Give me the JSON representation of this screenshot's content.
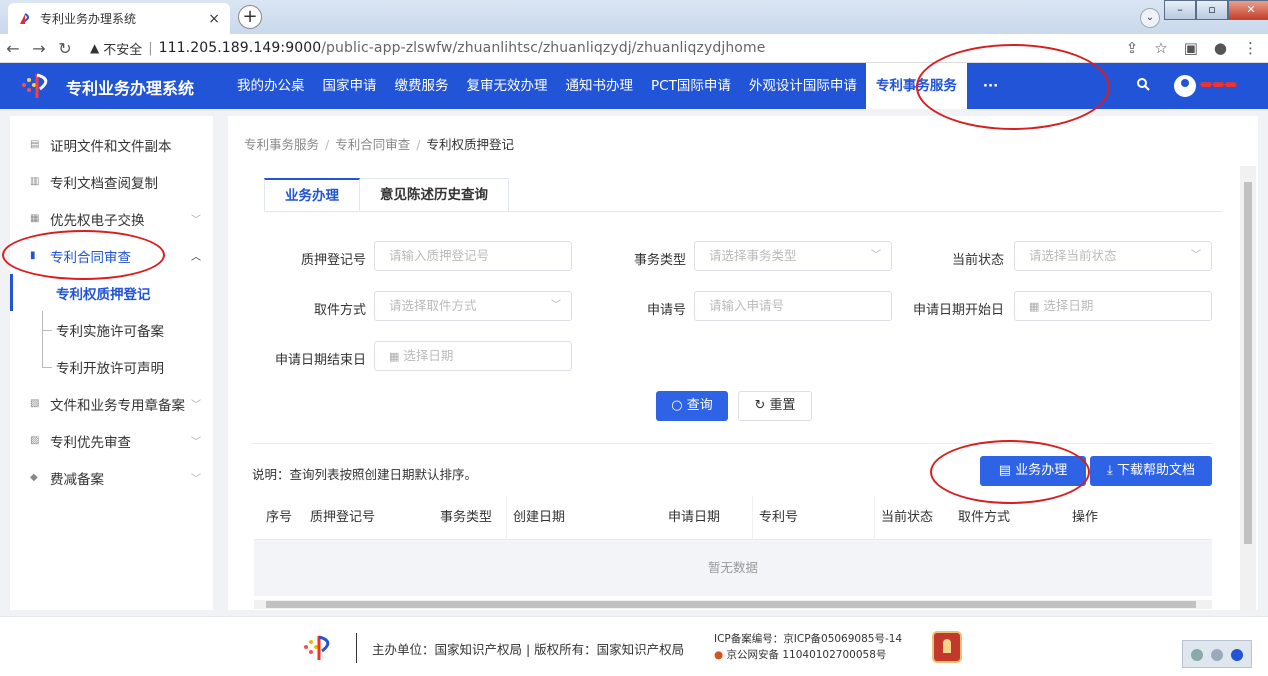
{
  "browser": {
    "tab_title": "专利业务办理系统",
    "tab_close": "×",
    "new_tab": "+",
    "security_label": "不安全",
    "url_host": "111.205.189.149:9000",
    "url_path": "/public-app-zlswfw/zhuanlihtsc/zhuanliqzydj/zhuanliqzydjhome"
  },
  "header": {
    "app_title": "专利业务办理系统",
    "nav": [
      "我的办公桌",
      "国家申请",
      "缴费服务",
      "复审无效办理",
      "通知书办理",
      "PCT国际申请",
      "外观设计国际申请",
      "专利事务服务",
      "···"
    ],
    "active_nav": "专利事务服务"
  },
  "sidebar": {
    "items": [
      {
        "label": "证明文件和文件副本",
        "icon": "document-icon"
      },
      {
        "label": "专利文档查阅复制",
        "icon": "copy-icon"
      },
      {
        "label": "优先权电子交换",
        "icon": "exchange-icon",
        "expandable": true
      },
      {
        "label": "专利合同审查",
        "icon": "contract-icon",
        "expandable": true,
        "open": true
      }
    ],
    "subitems": [
      "专利权质押登记",
      "专利实施许可备案",
      "专利开放许可声明"
    ],
    "items_after": [
      {
        "label": "文件和业务专用章备案",
        "icon": "stamp-icon",
        "expandable": true
      },
      {
        "label": "专利优先审查",
        "icon": "priority-icon",
        "expandable": true
      },
      {
        "label": "费减备案",
        "icon": "discount-icon",
        "expandable": true
      }
    ]
  },
  "breadcrumb": [
    "专利事务服务",
    "专利合同审查",
    "专利权质押登记"
  ],
  "tabs": [
    "业务办理",
    "意见陈述历史查询"
  ],
  "form": {
    "pledge_no_label": "质押登记号",
    "pledge_no_placeholder": "请输入质押登记号",
    "type_label": "事务类型",
    "type_placeholder": "请选择事务类型",
    "status_label": "当前状态",
    "status_placeholder": "请选择当前状态",
    "fetch_label": "取件方式",
    "fetch_placeholder": "请选择取件方式",
    "app_no_label": "申请号",
    "app_no_placeholder": "请输入申请号",
    "start_label": "申请日期开始日",
    "start_placeholder": "选择日期",
    "end_label": "申请日期结束日",
    "end_placeholder": "选择日期",
    "query_button": "查询",
    "reset_button": "重置"
  },
  "table": {
    "note": "说明：查询列表按照创建日期默认排序。",
    "handle_button": "业务办理",
    "download_button": "下载帮助文档",
    "columns": [
      "序号",
      "质押登记号",
      "事务类型",
      "创建日期",
      "申请日期",
      "专利号",
      "当前状态",
      "取件方式",
      "操作"
    ],
    "empty_text": "暂无数据"
  },
  "footer": {
    "host": "主办单位：国家知识产权局 | 版权所有：国家知识产权局",
    "icp": "ICP备案编号：京ICP备05069085号-14",
    "police": "京公网安备 11040102700058号"
  },
  "colors": {
    "brand": "#2154d6",
    "button": "#2f63e6",
    "annotation": "#d81e1e"
  }
}
